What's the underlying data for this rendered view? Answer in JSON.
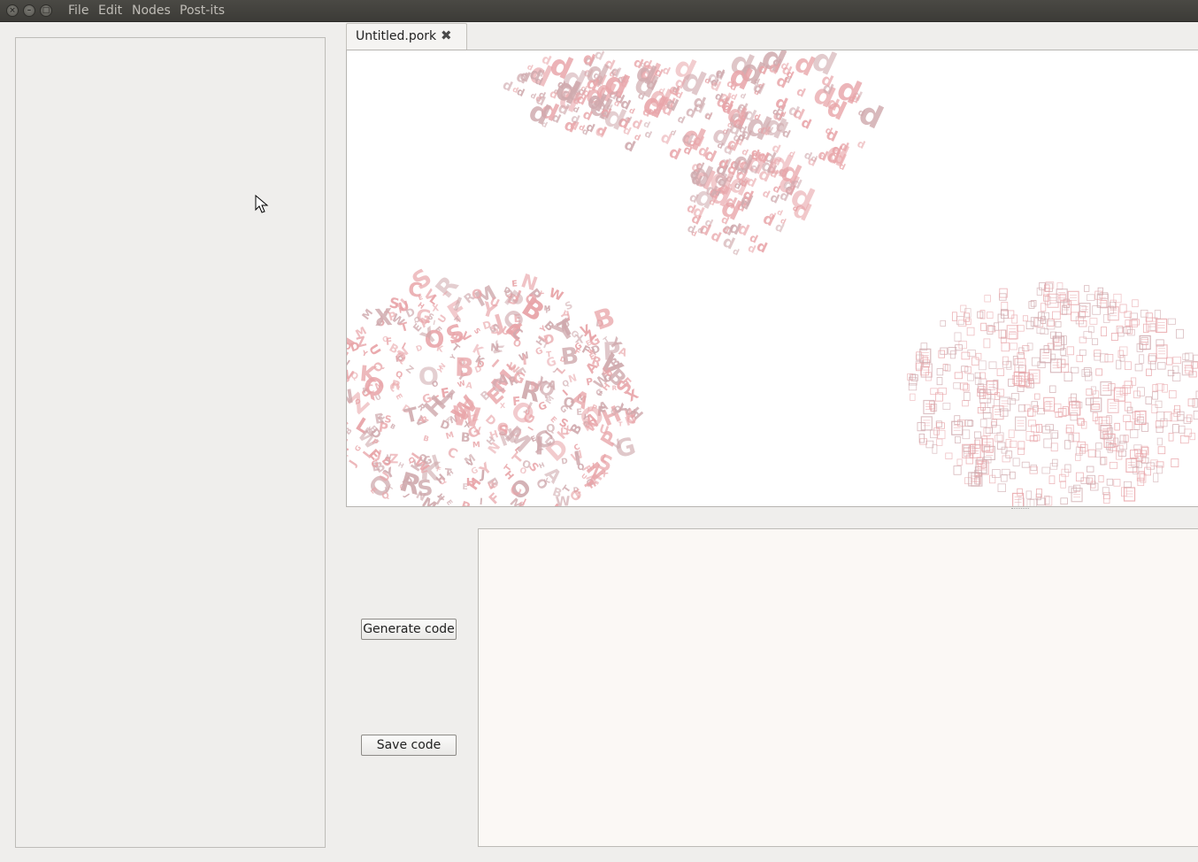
{
  "window": {
    "controls": [
      "close-icon",
      "minimize-icon",
      "maximize-icon"
    ]
  },
  "menubar": {
    "items": [
      {
        "label": "File"
      },
      {
        "label": "Edit"
      },
      {
        "label": "Nodes"
      },
      {
        "label": "Post-its"
      }
    ]
  },
  "editor": {
    "tab_label": "Untitled.pork",
    "tab_close_icon": "close-icon"
  },
  "canvas": {
    "clouds": [
      {
        "name": "letter-d-cloud",
        "glyph": "d"
      },
      {
        "name": "alphabet-cloud",
        "glyph": "A-Z"
      },
      {
        "name": "document-cloud",
        "glyph": "document-icon"
      }
    ],
    "cloud_color": "#e8a4a8",
    "cloud_color_alt": "#cfa9ad"
  },
  "actions": {
    "generate_label": "Generate code",
    "save_label": "Save code"
  },
  "code_output": {
    "value": ""
  }
}
